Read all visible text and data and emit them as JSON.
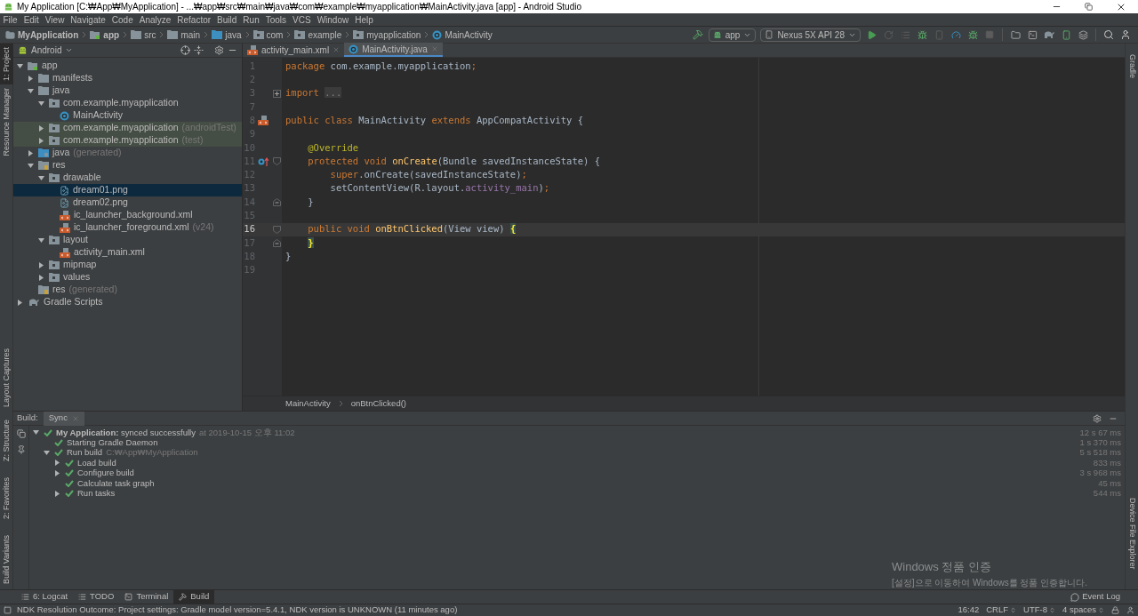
{
  "window": {
    "title": "My Application [C:₩App₩MyApplication] - ...₩app₩src₩main₩java₩com₩example₩myapplication₩MainActivity.java [app] - Android Studio"
  },
  "menu": [
    "File",
    "Edit",
    "View",
    "Navigate",
    "Code",
    "Analyze",
    "Refactor",
    "Build",
    "Run",
    "Tools",
    "VCS",
    "Window",
    "Help"
  ],
  "nav_path": [
    {
      "label": "MyApplication",
      "kind": "project"
    },
    {
      "label": "app",
      "kind": "module"
    },
    {
      "label": "src",
      "kind": "folder"
    },
    {
      "label": "main",
      "kind": "folder"
    },
    {
      "label": "java",
      "kind": "source"
    },
    {
      "label": "com",
      "kind": "package"
    },
    {
      "label": "example",
      "kind": "package"
    },
    {
      "label": "myapplication",
      "kind": "package"
    },
    {
      "label": "MainActivity",
      "kind": "class"
    }
  ],
  "toolbar": {
    "config": "app",
    "device": "Nexus 5X API 28"
  },
  "left_strip": {
    "top": [
      {
        "label": "1: Project",
        "selected": true
      },
      {
        "label": "Resource Manager",
        "selected": false
      }
    ],
    "middle": [
      {
        "label": "Layout Captures",
        "selected": false
      }
    ],
    "bottom": [
      {
        "label": "Z: Structure",
        "selected": false
      },
      {
        "label": "2: Favorites",
        "selected": false
      },
      {
        "label": "Build Variants",
        "selected": false
      }
    ]
  },
  "right_strip": {
    "top": [
      {
        "label": "Gradle"
      }
    ],
    "bottom": [
      {
        "label": "Device File Explorer"
      }
    ]
  },
  "project": {
    "view": "Android",
    "tree": [
      {
        "label": "app",
        "kind": "module",
        "expanded": true,
        "selected": false,
        "marked": false,
        "children": [
          {
            "label": "manifests",
            "kind": "folder",
            "expanded": false,
            "selected": false,
            "marked": false
          },
          {
            "label": "java",
            "kind": "folder",
            "expanded": true,
            "selected": false,
            "marked": false,
            "children": [
              {
                "label": "com.example.myapplication",
                "kind": "package",
                "expanded": true,
                "selected": false,
                "marked": false,
                "children": [
                  {
                    "label": "MainActivity",
                    "kind": "class",
                    "selected": false,
                    "marked": false
                  }
                ]
              },
              {
                "label": "com.example.myapplication",
                "suffix": "(androidTest)",
                "kind": "package",
                "expanded": false,
                "selected": false,
                "marked": true
              },
              {
                "label": "com.example.myapplication",
                "suffix": "(test)",
                "kind": "package",
                "expanded": false,
                "selected": false,
                "marked": true
              }
            ]
          },
          {
            "label": "java",
            "suffix": "(generated)",
            "kind": "generated",
            "expanded": false,
            "selected": false,
            "marked": false
          },
          {
            "label": "res",
            "kind": "res",
            "expanded": true,
            "selected": false,
            "marked": false,
            "children": [
              {
                "label": "drawable",
                "kind": "package",
                "expanded": true,
                "selected": false,
                "marked": false,
                "children": [
                  {
                    "label": "dream01.png",
                    "kind": "image",
                    "selected": true,
                    "marked": false
                  },
                  {
                    "label": "dream02.png",
                    "kind": "image",
                    "selected": false,
                    "marked": false
                  },
                  {
                    "label": "ic_launcher_background.xml",
                    "kind": "xml",
                    "selected": false,
                    "marked": false
                  },
                  {
                    "label": "ic_launcher_foreground.xml",
                    "suffix": "(v24)",
                    "kind": "xml",
                    "selected": false,
                    "marked": false
                  }
                ]
              },
              {
                "label": "layout",
                "kind": "package",
                "expanded": true,
                "selected": false,
                "marked": false,
                "children": [
                  {
                    "label": "activity_main.xml",
                    "kind": "xml",
                    "selected": false,
                    "marked": false
                  }
                ]
              },
              {
                "label": "mipmap",
                "kind": "package",
                "expanded": false,
                "selected": false,
                "marked": false
              },
              {
                "label": "values",
                "kind": "package",
                "expanded": false,
                "selected": false,
                "marked": false
              }
            ]
          },
          {
            "label": "res",
            "suffix": "(generated)",
            "kind": "res",
            "selected": false,
            "marked": false
          }
        ]
      },
      {
        "label": "Gradle Scripts",
        "kind": "gradle",
        "expanded": false,
        "selected": false,
        "marked": false
      }
    ]
  },
  "editor": {
    "tabs": [
      {
        "label": "activity_main.xml",
        "kind": "xml",
        "selected": false
      },
      {
        "label": "MainActivity.java",
        "kind": "class",
        "selected": true
      }
    ],
    "lines": [
      {
        "number": "1",
        "current": false,
        "tokens": [
          {
            "text": "package",
            "kind": "keyword"
          },
          {
            "text": " com.example.myapplication",
            "kind": "plain"
          },
          {
            "text": ";",
            "kind": "keyword"
          }
        ]
      },
      {
        "number": "2",
        "current": false
      },
      {
        "number": "3",
        "current": false,
        "fold_marker": {
          "kind": "collapsed"
        },
        "tokens": [
          {
            "text": "import ",
            "kind": "keyword"
          },
          {
            "text": "...",
            "kind": "folded"
          }
        ]
      },
      {
        "number": "7",
        "current": false
      },
      {
        "number": "8",
        "current": false,
        "gutter_icon": {
          "kind": "layout"
        },
        "tokens": [
          {
            "text": "public class",
            "kind": "keyword"
          },
          {
            "text": " MainActivity ",
            "kind": "plain"
          },
          {
            "text": "extends",
            "kind": "keyword"
          },
          {
            "text": " AppCompatActivity {",
            "kind": "plain"
          }
        ]
      },
      {
        "number": "9",
        "current": false
      },
      {
        "number": "10",
        "current": false,
        "tokens": [
          {
            "text": "    @Override",
            "kind": "annotation"
          }
        ]
      },
      {
        "number": "11",
        "current": false,
        "gutter_icon": {
          "kind": "override"
        },
        "fold_marker": {
          "kind": "start"
        },
        "tokens": [
          {
            "text": "    protected void ",
            "kind": "keyword"
          },
          {
            "text": "onCreate",
            "kind": "method"
          },
          {
            "text": "(Bundle savedInstanceState) {",
            "kind": "plain"
          }
        ]
      },
      {
        "number": "12",
        "current": false,
        "tokens": [
          {
            "text": "        super",
            "kind": "keyword"
          },
          {
            "text": ".onCreate(savedInstanceState)",
            "kind": "plain"
          },
          {
            "text": ";",
            "kind": "keyword"
          }
        ]
      },
      {
        "number": "13",
        "current": false,
        "tokens": [
          {
            "text": "        setContentView(R.layout.",
            "kind": "plain"
          },
          {
            "text": "activity_main",
            "kind": "field"
          },
          {
            "text": ")",
            "kind": "plain"
          },
          {
            "text": ";",
            "kind": "keyword"
          }
        ]
      },
      {
        "number": "14",
        "current": false,
        "fold_marker": {
          "kind": "end"
        },
        "tokens": [
          {
            "text": "    }",
            "kind": "plain"
          }
        ]
      },
      {
        "number": "15",
        "current": false
      },
      {
        "number": "16",
        "current": true,
        "fold_marker": {
          "kind": "start"
        },
        "tokens": [
          {
            "text": "    public void ",
            "kind": "keyword"
          },
          {
            "text": "onBtnClicked",
            "kind": "method"
          },
          {
            "text": "(View view) ",
            "kind": "plain"
          },
          {
            "text": "{",
            "kind": "match"
          }
        ]
      },
      {
        "number": "17",
        "current": false,
        "fold_marker": {
          "kind": "end"
        },
        "tokens": [
          {
            "text": "    }",
            "kind": "match"
          }
        ]
      },
      {
        "number": "18",
        "current": false,
        "tokens": [
          {
            "text": "}",
            "kind": "plain"
          }
        ]
      },
      {
        "number": "19",
        "current": false
      }
    ],
    "breadcrumbs": [
      "MainActivity",
      "onBtnClicked()"
    ]
  },
  "build": {
    "label": "Build:",
    "tabs": [
      {
        "label": "Sync",
        "selected": true
      }
    ],
    "tree": [
      {
        "label": "**My Application:** synced successfully",
        "detail": "at 2019-10-15 오후 11:02",
        "duration": "12 s 67 ms",
        "expanded": true,
        "children": [
          {
            "label": "Starting Gradle Daemon",
            "duration": "1 s 370 ms"
          },
          {
            "label": "Run build",
            "detail": "C:₩App₩MyApplication",
            "duration": "5 s 518 ms",
            "expanded": true,
            "children": [
              {
                "label": "Load build",
                "duration": "833 ms",
                "expanded": false
              },
              {
                "label": "Configure build",
                "duration": "3 s 968 ms",
                "expanded": false
              },
              {
                "label": "Calculate task graph",
                "duration": "45 ms"
              },
              {
                "label": "Run tasks",
                "duration": "544 ms",
                "expanded": false
              }
            ]
          }
        ]
      }
    ]
  },
  "os_watermark": {
    "title": "Windows 정품 인증",
    "text": "[설정]으로 이동하여 Windows를 정품 인증합니다."
  },
  "tool_tabs": [
    {
      "label": "6: Logcat",
      "kind": "logcat",
      "selected": false
    },
    {
      "label": "TODO",
      "kind": "todo",
      "selected": false
    },
    {
      "label": "Terminal",
      "kind": "terminal",
      "selected": false
    },
    {
      "label": "Build",
      "kind": "build",
      "selected": true
    }
  ],
  "event_log": "Event Log",
  "status_bar": {
    "message": "NDK Resolution Outcome: Project settings: Gradle model version=5.4.1, NDK version is UNKNOWN (11 minutes ago)",
    "position": "16:42",
    "line_separator": "CRLF",
    "encoding": "UTF-8",
    "indent": "4 spaces"
  }
}
